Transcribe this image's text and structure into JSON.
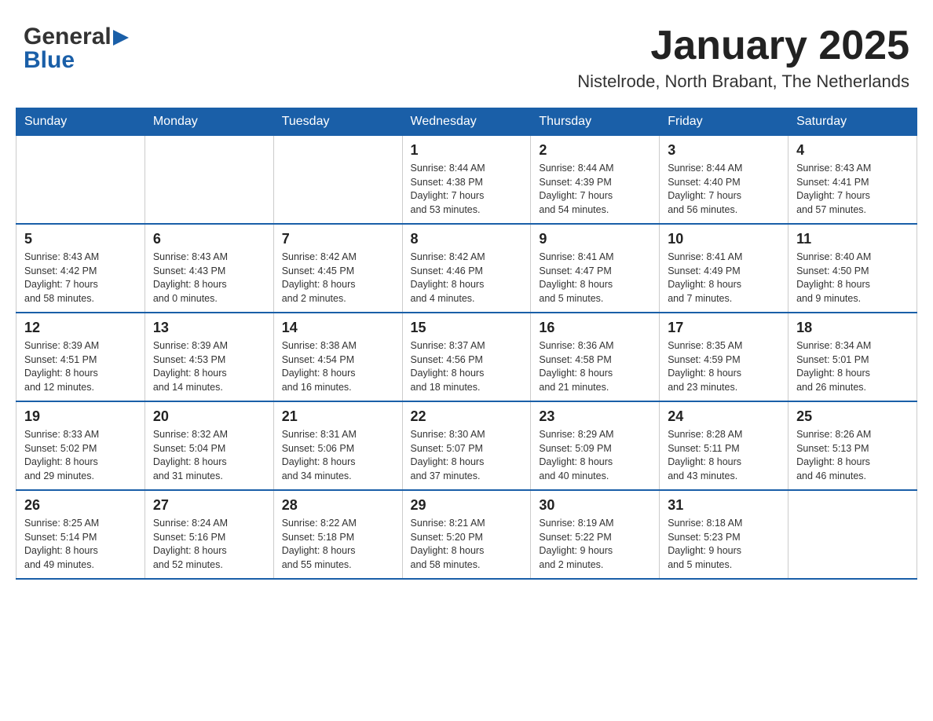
{
  "logo": {
    "general": "General",
    "blue": "Blue",
    "arrow": "▶"
  },
  "title": {
    "month": "January 2025",
    "location": "Nistelrode, North Brabant, The Netherlands"
  },
  "weekdays": [
    "Sunday",
    "Monday",
    "Tuesday",
    "Wednesday",
    "Thursday",
    "Friday",
    "Saturday"
  ],
  "weeks": [
    [
      {
        "day": "",
        "info": ""
      },
      {
        "day": "",
        "info": ""
      },
      {
        "day": "",
        "info": ""
      },
      {
        "day": "1",
        "info": "Sunrise: 8:44 AM\nSunset: 4:38 PM\nDaylight: 7 hours\nand 53 minutes."
      },
      {
        "day": "2",
        "info": "Sunrise: 8:44 AM\nSunset: 4:39 PM\nDaylight: 7 hours\nand 54 minutes."
      },
      {
        "day": "3",
        "info": "Sunrise: 8:44 AM\nSunset: 4:40 PM\nDaylight: 7 hours\nand 56 minutes."
      },
      {
        "day": "4",
        "info": "Sunrise: 8:43 AM\nSunset: 4:41 PM\nDaylight: 7 hours\nand 57 minutes."
      }
    ],
    [
      {
        "day": "5",
        "info": "Sunrise: 8:43 AM\nSunset: 4:42 PM\nDaylight: 7 hours\nand 58 minutes."
      },
      {
        "day": "6",
        "info": "Sunrise: 8:43 AM\nSunset: 4:43 PM\nDaylight: 8 hours\nand 0 minutes."
      },
      {
        "day": "7",
        "info": "Sunrise: 8:42 AM\nSunset: 4:45 PM\nDaylight: 8 hours\nand 2 minutes."
      },
      {
        "day": "8",
        "info": "Sunrise: 8:42 AM\nSunset: 4:46 PM\nDaylight: 8 hours\nand 4 minutes."
      },
      {
        "day": "9",
        "info": "Sunrise: 8:41 AM\nSunset: 4:47 PM\nDaylight: 8 hours\nand 5 minutes."
      },
      {
        "day": "10",
        "info": "Sunrise: 8:41 AM\nSunset: 4:49 PM\nDaylight: 8 hours\nand 7 minutes."
      },
      {
        "day": "11",
        "info": "Sunrise: 8:40 AM\nSunset: 4:50 PM\nDaylight: 8 hours\nand 9 minutes."
      }
    ],
    [
      {
        "day": "12",
        "info": "Sunrise: 8:39 AM\nSunset: 4:51 PM\nDaylight: 8 hours\nand 12 minutes."
      },
      {
        "day": "13",
        "info": "Sunrise: 8:39 AM\nSunset: 4:53 PM\nDaylight: 8 hours\nand 14 minutes."
      },
      {
        "day": "14",
        "info": "Sunrise: 8:38 AM\nSunset: 4:54 PM\nDaylight: 8 hours\nand 16 minutes."
      },
      {
        "day": "15",
        "info": "Sunrise: 8:37 AM\nSunset: 4:56 PM\nDaylight: 8 hours\nand 18 minutes."
      },
      {
        "day": "16",
        "info": "Sunrise: 8:36 AM\nSunset: 4:58 PM\nDaylight: 8 hours\nand 21 minutes."
      },
      {
        "day": "17",
        "info": "Sunrise: 8:35 AM\nSunset: 4:59 PM\nDaylight: 8 hours\nand 23 minutes."
      },
      {
        "day": "18",
        "info": "Sunrise: 8:34 AM\nSunset: 5:01 PM\nDaylight: 8 hours\nand 26 minutes."
      }
    ],
    [
      {
        "day": "19",
        "info": "Sunrise: 8:33 AM\nSunset: 5:02 PM\nDaylight: 8 hours\nand 29 minutes."
      },
      {
        "day": "20",
        "info": "Sunrise: 8:32 AM\nSunset: 5:04 PM\nDaylight: 8 hours\nand 31 minutes."
      },
      {
        "day": "21",
        "info": "Sunrise: 8:31 AM\nSunset: 5:06 PM\nDaylight: 8 hours\nand 34 minutes."
      },
      {
        "day": "22",
        "info": "Sunrise: 8:30 AM\nSunset: 5:07 PM\nDaylight: 8 hours\nand 37 minutes."
      },
      {
        "day": "23",
        "info": "Sunrise: 8:29 AM\nSunset: 5:09 PM\nDaylight: 8 hours\nand 40 minutes."
      },
      {
        "day": "24",
        "info": "Sunrise: 8:28 AM\nSunset: 5:11 PM\nDaylight: 8 hours\nand 43 minutes."
      },
      {
        "day": "25",
        "info": "Sunrise: 8:26 AM\nSunset: 5:13 PM\nDaylight: 8 hours\nand 46 minutes."
      }
    ],
    [
      {
        "day": "26",
        "info": "Sunrise: 8:25 AM\nSunset: 5:14 PM\nDaylight: 8 hours\nand 49 minutes."
      },
      {
        "day": "27",
        "info": "Sunrise: 8:24 AM\nSunset: 5:16 PM\nDaylight: 8 hours\nand 52 minutes."
      },
      {
        "day": "28",
        "info": "Sunrise: 8:22 AM\nSunset: 5:18 PM\nDaylight: 8 hours\nand 55 minutes."
      },
      {
        "day": "29",
        "info": "Sunrise: 8:21 AM\nSunset: 5:20 PM\nDaylight: 8 hours\nand 58 minutes."
      },
      {
        "day": "30",
        "info": "Sunrise: 8:19 AM\nSunset: 5:22 PM\nDaylight: 9 hours\nand 2 minutes."
      },
      {
        "day": "31",
        "info": "Sunrise: 8:18 AM\nSunset: 5:23 PM\nDaylight: 9 hours\nand 5 minutes."
      },
      {
        "day": "",
        "info": ""
      }
    ]
  ]
}
